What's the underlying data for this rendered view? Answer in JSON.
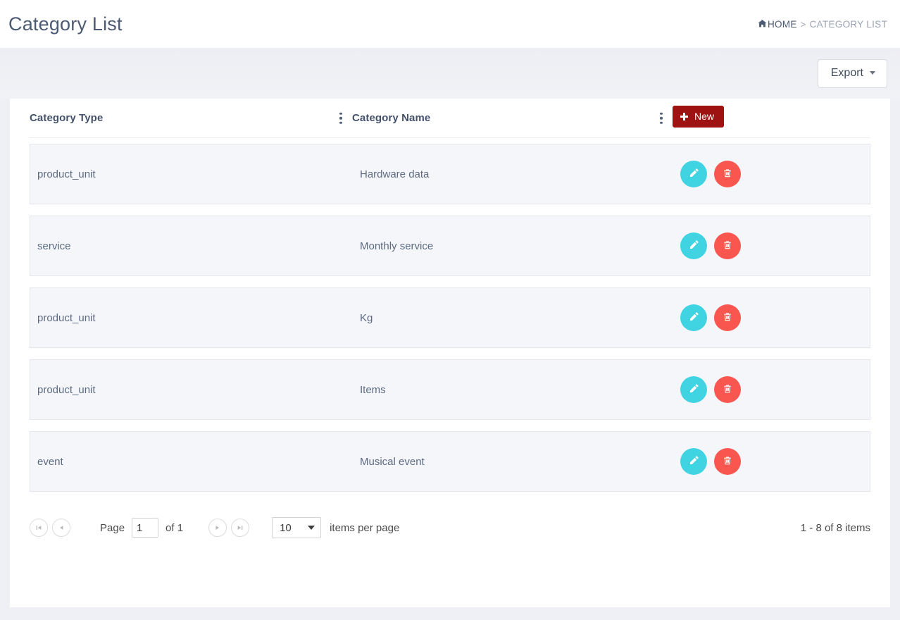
{
  "header": {
    "title": "Category List",
    "breadcrumb": {
      "home_icon": "home-icon",
      "home": "HOME",
      "separator": ">",
      "current": "CATEGORY LIST"
    }
  },
  "toolbar": {
    "export_label": "Export",
    "export_caret": "caret-down-icon"
  },
  "grid": {
    "columns": [
      {
        "label": "Category Type",
        "menu_icon": "kebab-menu-icon"
      },
      {
        "label": "Category Name",
        "menu_icon": "kebab-menu-icon"
      }
    ],
    "new_button": {
      "label": "New",
      "icon": "plus-icon"
    },
    "actions": {
      "edit_icon": "pencil-icon",
      "delete_icon": "trash-icon"
    },
    "rows": [
      {
        "type": "product_unit",
        "name": "Hardware data"
      },
      {
        "type": "service",
        "name": "Monthly service"
      },
      {
        "type": "product_unit",
        "name": "Kg"
      },
      {
        "type": "product_unit",
        "name": "Items"
      },
      {
        "type": "event",
        "name": "Musical event"
      }
    ]
  },
  "pager": {
    "first_icon": "first-page-icon",
    "prev_icon": "previous-page-icon",
    "next_icon": "next-page-icon",
    "last_icon": "last-page-icon",
    "page_label": "Page",
    "page_value": "1",
    "of_label": "of 1",
    "page_size": "10",
    "page_size_caret": "caret-down-icon",
    "items_per_page_label": "items per page",
    "item_range": "1 - 8 of 8 items"
  },
  "colors": {
    "new_button": "#9e1212",
    "edit_button": "#40d3e2",
    "delete_button": "#f8564e",
    "row_bg": "#f4f6fa",
    "page_bg": "#eef0f5"
  }
}
